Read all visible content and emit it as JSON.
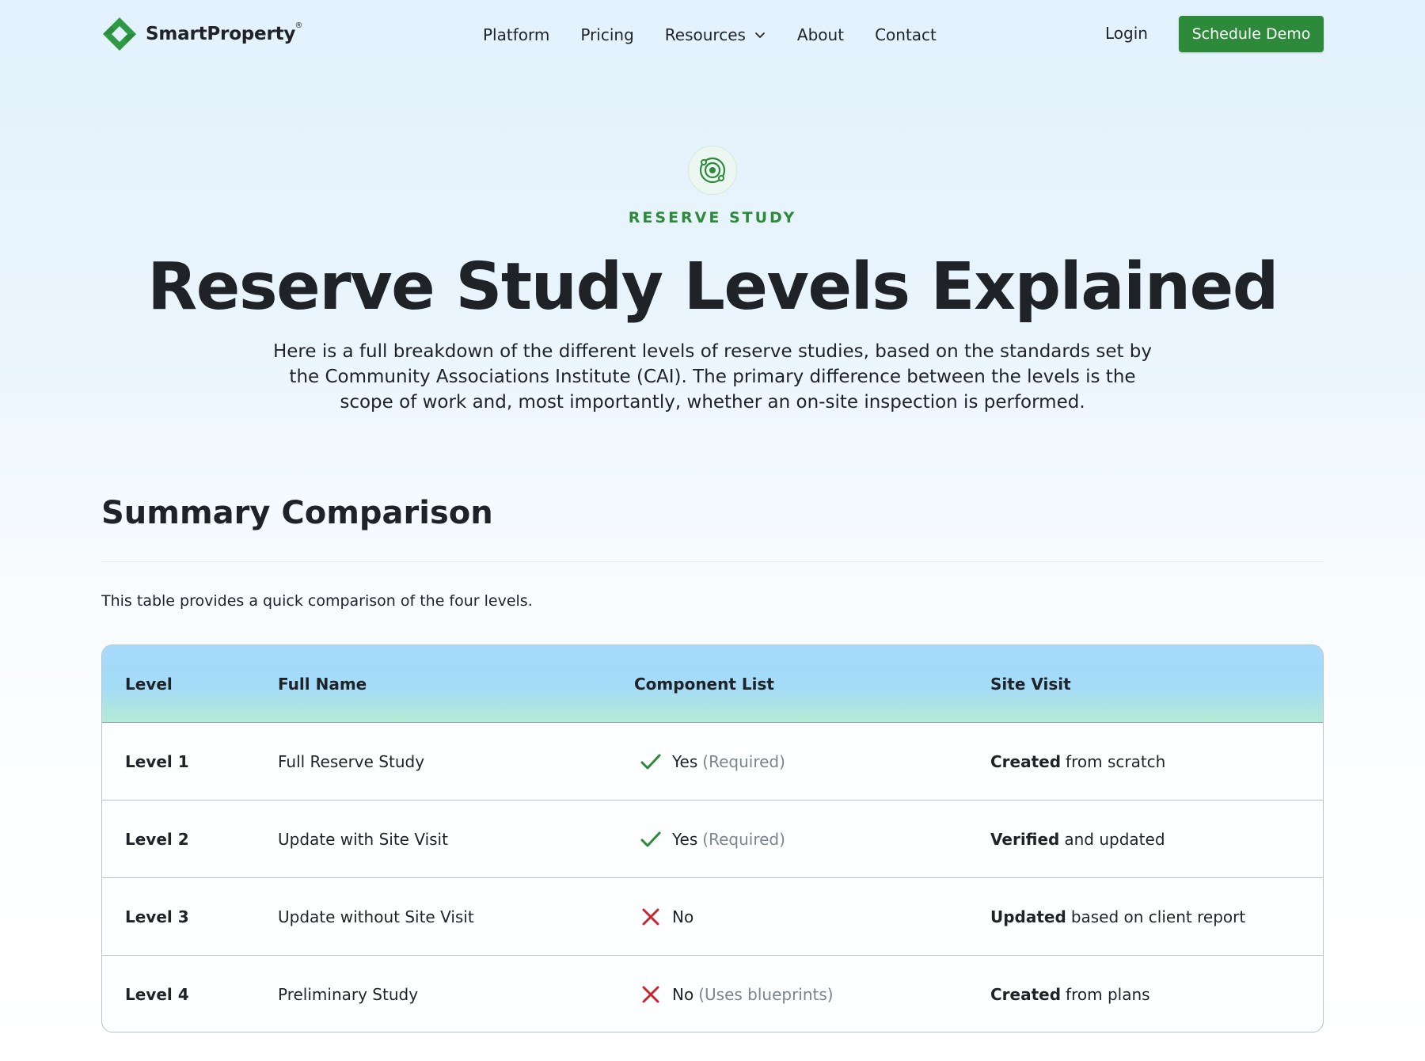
{
  "header": {
    "logo_text": "SmartProperty",
    "logo_reg": "®",
    "nav": [
      {
        "label": "Platform"
      },
      {
        "label": "Pricing"
      },
      {
        "label": "Resources"
      },
      {
        "label": "About"
      },
      {
        "label": "Contact"
      }
    ],
    "login_label": "Login",
    "demo_label": "Schedule Demo"
  },
  "hero": {
    "icon": "target-icon",
    "eyebrow": "RESERVE STUDY",
    "title": "Reserve Study Levels Explained",
    "description": "Here is a full breakdown of the different levels of reserve studies, based on the standards set by the Community Associations Institute (CAI). The primary difference between the levels is the scope of work and, most importantly, whether an on-site inspection is performed."
  },
  "section": {
    "title": "Summary Comparison",
    "intro": "This table provides a quick comparison of the four levels."
  },
  "table": {
    "headers": [
      "Level",
      "Full Name",
      "Component List",
      "Site Visit"
    ],
    "rows": [
      {
        "level": "Level 1",
        "full_name": "Full Reserve Study",
        "component_status": "check",
        "component_value": "Yes",
        "component_note": "(Required)",
        "site_strong": "Created",
        "site_rest": "from scratch"
      },
      {
        "level": "Level 2",
        "full_name": "Update with Site Visit",
        "component_status": "check",
        "component_value": "Yes",
        "component_note": "(Required)",
        "site_strong": "Verified",
        "site_rest": "and updated"
      },
      {
        "level": "Level 3",
        "full_name": "Update without Site Visit",
        "component_status": "cross",
        "component_value": "No",
        "component_note": "",
        "site_strong": "Updated",
        "site_rest": "based on client report"
      },
      {
        "level": "Level 4",
        "full_name": "Preliminary Study",
        "component_status": "cross",
        "component_value": "No",
        "component_note": "(Uses blueprints)",
        "site_strong": "Created",
        "site_rest": "from plans"
      }
    ]
  },
  "colors": {
    "brand_green": "#2e8a3b",
    "check_green": "#2e8a3b",
    "cross_red": "#c8262c",
    "header_blue": "#a5dafa"
  }
}
